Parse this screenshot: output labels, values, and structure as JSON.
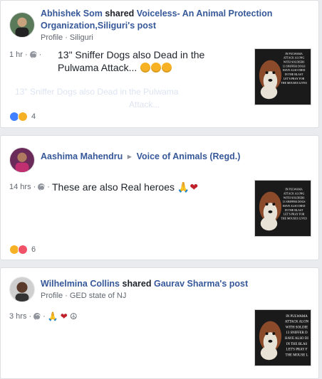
{
  "posts": [
    {
      "actor": "Abhishek Som",
      "verb": "shared",
      "target": "Voiceless- An Animal Protection Organization,Siliguri's post",
      "sub_label": "Profile",
      "sub_place": "Siliguri",
      "time": "1 hr",
      "text": "13\" Sniffer Dogs also Dead in the Pulwama Attack...",
      "reaction_count": "4"
    },
    {
      "actor": "Aashima Mahendru",
      "separator": "▸",
      "target": "Voice of Animals (Regd.)",
      "time": "14 hrs",
      "text": "These are also Real heroes",
      "reaction_count": "6"
    },
    {
      "actor": "Wilhelmina Collins",
      "verb": "shared",
      "target": "Gaurav Sharma's post",
      "sub_label": "Profile",
      "sub_place": "GED state of NJ",
      "time": "3 hrs"
    }
  ],
  "thumb_text_lines": [
    "IN PULWAMA",
    "ATTACK ALONG",
    "WITH SOLDIERS",
    "13 SNIFFER DOGS",
    "HAVE ALSO DIED",
    "IN THE BLAST",
    "LET'S PRAY FOR",
    "THE MOUSES LIVES"
  ],
  "colors": {
    "link": "#365899",
    "meta": "#616770",
    "like": "#4080ff",
    "sad": "#f7b125",
    "love": "#f25268"
  }
}
